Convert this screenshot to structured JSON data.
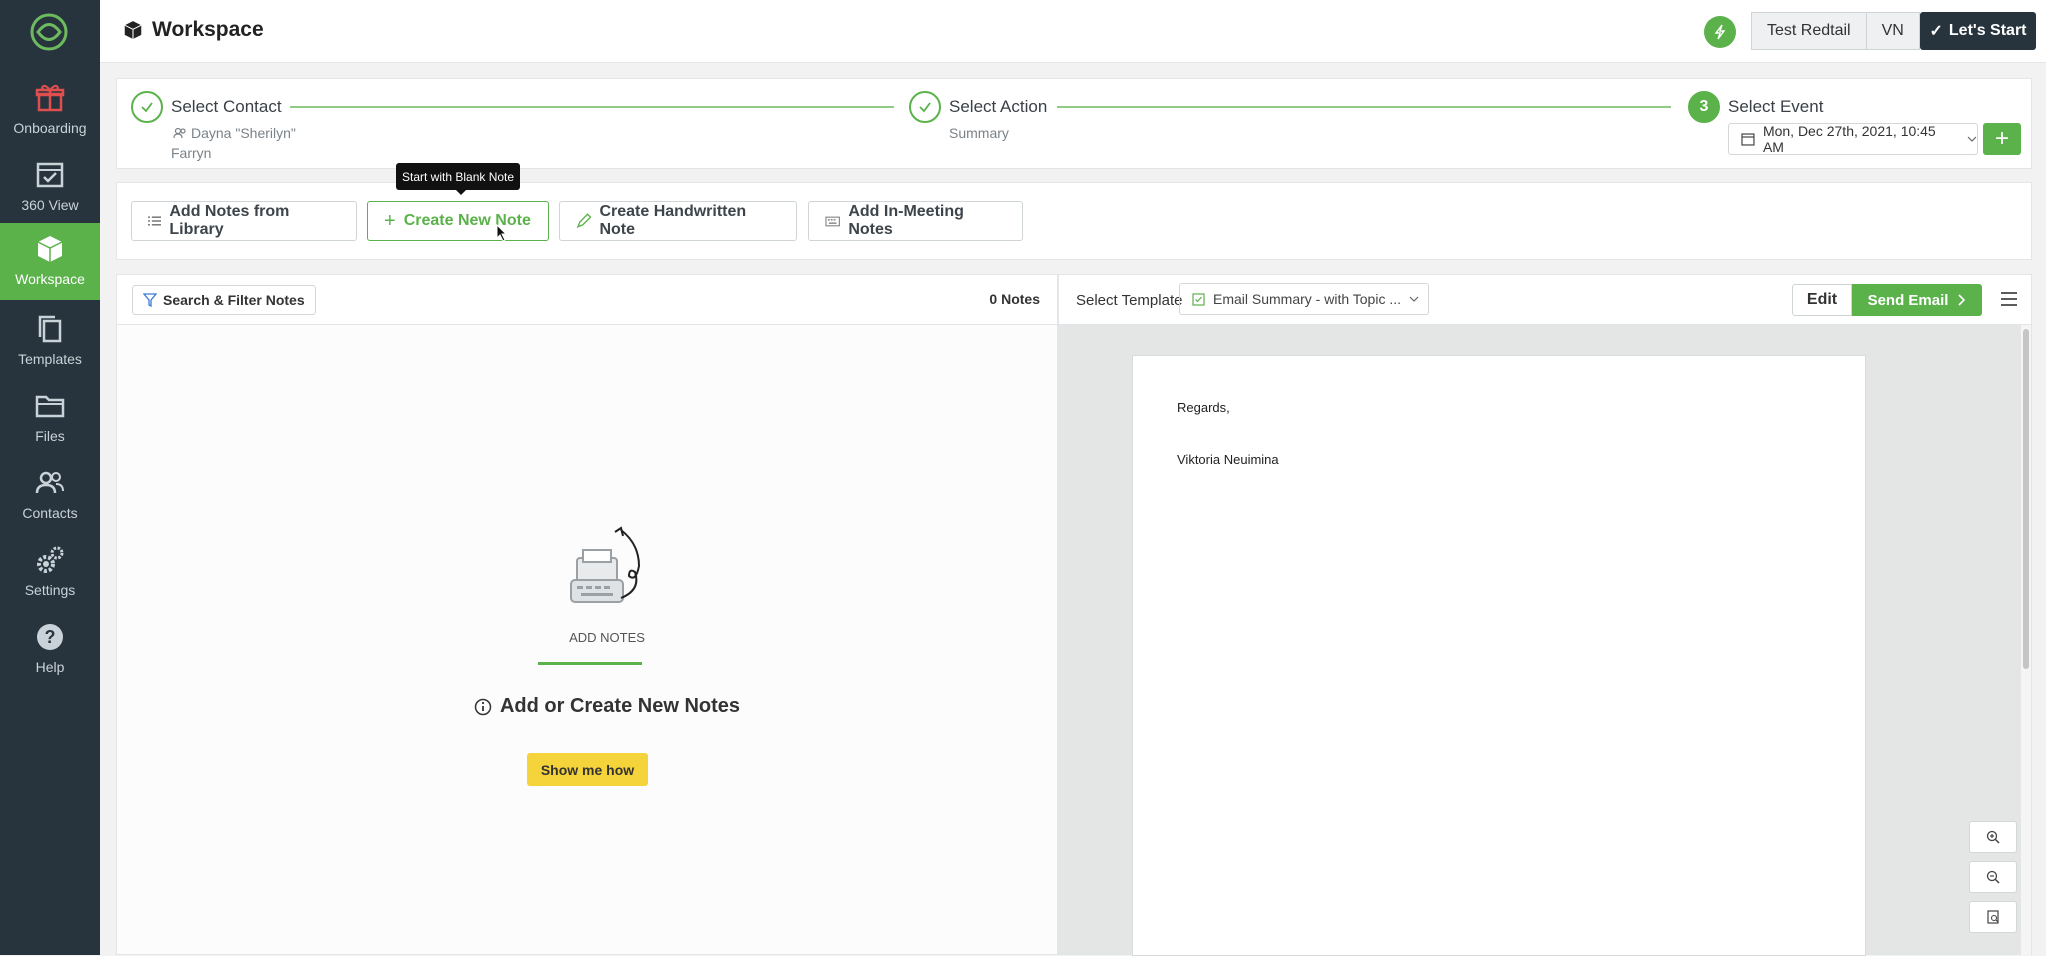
{
  "app": {
    "title": "Workspace"
  },
  "sidebar": {
    "items": [
      {
        "label": "Onboarding",
        "icon": "gift-icon"
      },
      {
        "label": "360 View",
        "icon": "calendar-check-icon"
      },
      {
        "label": "Workspace",
        "icon": "cube-icon",
        "active": true
      },
      {
        "label": "Templates",
        "icon": "copy-icon"
      },
      {
        "label": "Files",
        "icon": "folder-icon"
      },
      {
        "label": "Contacts",
        "icon": "people-icon"
      },
      {
        "label": "Settings",
        "icon": "gears-icon"
      },
      {
        "label": "Help",
        "icon": "question-icon"
      }
    ]
  },
  "header": {
    "account": "Test Redtail",
    "initials": "VN",
    "lets_start": "Let's Start"
  },
  "steps": {
    "contact": {
      "label": "Select Contact",
      "sub1": "Dayna \"Sherilyn\"",
      "sub2": "Farryn"
    },
    "action": {
      "label": "Select Action",
      "sub": "Summary"
    },
    "event": {
      "number": "3",
      "label": "Select Event",
      "date": "Mon, Dec 27th, 2021, 10:45 AM"
    }
  },
  "tooltip": "Start with Blank Note",
  "actions": {
    "library": "Add Notes from Library",
    "new_note": "Create New Note",
    "handwritten": "Create Handwritten Note",
    "in_meeting": "Add In-Meeting Notes"
  },
  "notes_panel": {
    "filter": "Search & Filter Notes",
    "count": "0 Notes",
    "empty_label": "ADD NOTES",
    "heading": "Add or Create New Notes",
    "show_me": "Show me how"
  },
  "preview": {
    "select_template_label": "Select Template",
    "template": "Email Summary - with Topic ...",
    "edit": "Edit",
    "send": "Send Email",
    "doc_line1": "Regards,",
    "doc_line2": "Viktoria Neuimina"
  },
  "colors": {
    "accent": "#5bb24b",
    "sidebar": "#27343d",
    "highlight": "#f5d33a"
  }
}
